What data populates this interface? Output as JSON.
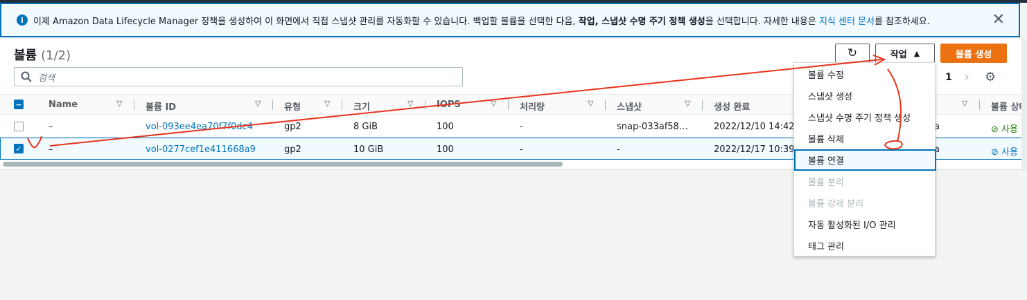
{
  "banner": {
    "pre": "이제 Amazon Data Lifecycle Manager 정책을 생성하여 이 화면에서 직접 스냅샷 관리를 자동화할 수 있습니다. 백업할 볼륨을 선택한 다음, ",
    "bold": "작업, 스냅샷 수명 주기 정책 생성",
    "mid": "을 선택합니다. 자세한 내용은 ",
    "link": "지식 센터 문서",
    "post": "를 참조하세요.",
    "close": "✕"
  },
  "header": {
    "title": "볼륨",
    "count": "(1/2)"
  },
  "toolbar": {
    "refresh": "↻",
    "actions": "작업",
    "actions_caret": "▲",
    "create": "볼륨 생성"
  },
  "search": {
    "placeholder": "검색"
  },
  "pager": {
    "page": "1",
    "next": "›",
    "settings": "⚙"
  },
  "columns": [
    "Name",
    "볼륨 ID",
    "유형",
    "크기",
    "IOPS",
    "처리량",
    "스냅샷",
    "생성 완료",
    "볼륨 상태"
  ],
  "rows": [
    {
      "name": "–",
      "id": "vol-093ee4ea70f7f0dc4",
      "type": "gp2",
      "size": "8 GiB",
      "iops": "100",
      "throughput": "-",
      "snapshot": "snap-033af58…",
      "created": "2022/12/10 14:42",
      "az": "a",
      "state": "사용"
    },
    {
      "name": "–",
      "id": "vol-0277cef1e411668a9",
      "type": "gp2",
      "size": "10 GiB",
      "iops": "100",
      "throughput": "-",
      "snapshot": "-",
      "created": "2022/12/17 10:39",
      "az": "a",
      "state": "사용"
    }
  ],
  "menu": [
    {
      "label": "볼륨 수정",
      "state": "normal"
    },
    {
      "label": "스냅샷 생성",
      "state": "normal"
    },
    {
      "label": "스냅샷 수명 주기 정책 생성",
      "state": "normal"
    },
    {
      "label": "볼륨 삭제",
      "state": "normal"
    },
    {
      "label": "볼륨 연결",
      "state": "highlighted"
    },
    {
      "label": "볼륨 분리",
      "state": "disabled"
    },
    {
      "label": "볼륨 강제 분리",
      "state": "disabled"
    },
    {
      "label": "자동 활성화된 I/O 관리",
      "state": "normal"
    },
    {
      "label": "태그 관리",
      "state": "normal"
    }
  ],
  "colors": {
    "primary": "#ec7211",
    "link": "#0073bb",
    "annotation": "#e8341c",
    "success": "#1d8102"
  }
}
